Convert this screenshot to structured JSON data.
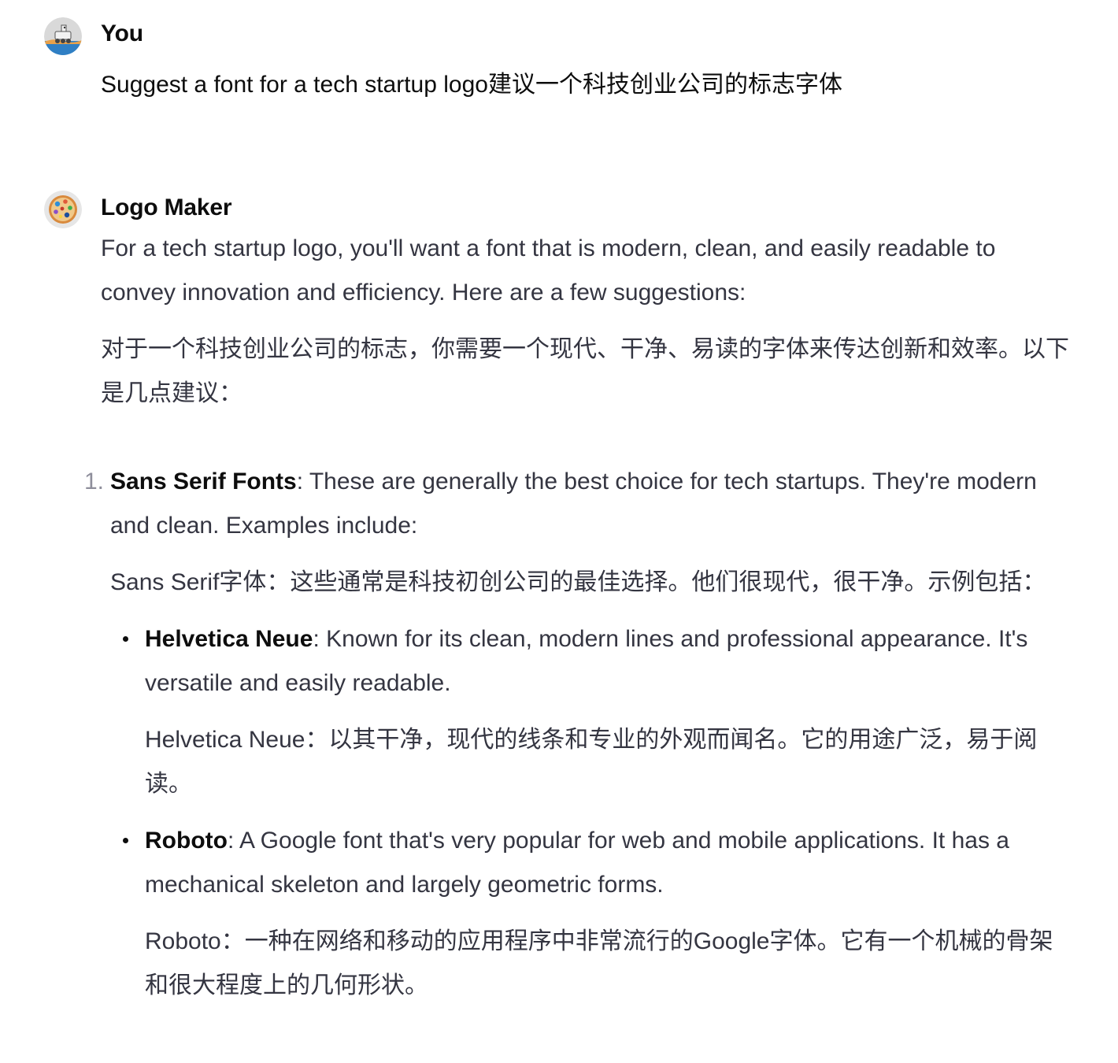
{
  "user_message": {
    "author": "You",
    "avatar_icon": "astronaut-rover-avatar-icon",
    "text": "Suggest a font for a tech startup logo建议一个科技创业公司的标志字体"
  },
  "bot_message": {
    "author": "Logo Maker",
    "avatar_icon": "palette-avatar-icon",
    "intro_en": "For a tech startup logo, you'll want a font that is modern, clean, and easily readable to convey innovation and efficiency. Here are a few suggestions:",
    "intro_zh": "对于一个科技创业公司的标志，你需要一个现代、干净、易读的字体来传达创新和效率。以下是几点建议：",
    "list": [
      {
        "number": "1.",
        "title": "Sans Serif Fonts",
        "text_en": ": These are generally the best choice for tech startups. They're modern and clean. Examples include:",
        "text_zh": "Sans Serif字体：这些通常是科技初创公司的最佳选择。他们很现代，很干净。示例包括：",
        "bullets": [
          {
            "title": "Helvetica Neue",
            "text_en": ": Known for its clean, modern lines and professional appearance. It's versatile and easily readable.",
            "text_zh": "Helvetica Neue：以其干净，现代的线条和专业的外观而闻名。它的用途广泛，易于阅读。"
          },
          {
            "title": "Roboto",
            "text_en": ": A Google font that's very popular for web and mobile applications. It has a mechanical skeleton and largely geometric forms.",
            "text_zh": "Roboto：一种在网络和移动的应用程序中非常流行的Google字体。它有一个机械的骨架和很大程度上的几何形状。"
          }
        ]
      }
    ]
  },
  "colors": {
    "text_primary": "#0d0d0d",
    "text_body": "#343541",
    "list_number": "#8e8e9b",
    "background": "#ffffff"
  }
}
